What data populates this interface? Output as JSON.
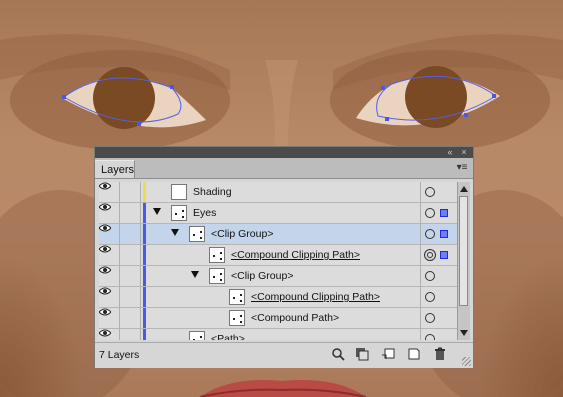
{
  "panel": {
    "tab_label": "Layers",
    "collapse_icon": "double-chevron-icon",
    "close_icon": "close-icon",
    "menu_icon": "panel-menu-icon"
  },
  "layers": [
    {
      "name": "Shading",
      "color": "#e8e04a",
      "indent": 0,
      "twisty": false,
      "underline": false,
      "selected": false,
      "target": "circle",
      "selected_art": false
    },
    {
      "name": "Eyes",
      "color": "#4a57e8",
      "indent": 0,
      "twisty": true,
      "underline": false,
      "selected": false,
      "target": "circle",
      "selected_art": true
    },
    {
      "name": "<Clip Group>",
      "color": "#4a57e8",
      "indent": 1,
      "twisty": true,
      "underline": false,
      "selected": true,
      "target": "circle",
      "selected_art": true
    },
    {
      "name": "<Compound Clipping Path>",
      "color": "#4a57e8",
      "indent": 2,
      "twisty": false,
      "underline": true,
      "selected": false,
      "target": "ring",
      "selected_art": true
    },
    {
      "name": "<Clip Group>",
      "color": "#4a57e8",
      "indent": 2,
      "twisty": true,
      "underline": false,
      "selected": false,
      "target": "circle",
      "selected_art": false
    },
    {
      "name": "<Compound Clipping Path>",
      "color": "#4a57e8",
      "indent": 3,
      "twisty": false,
      "underline": true,
      "selected": false,
      "target": "circle",
      "selected_art": false
    },
    {
      "name": "<Compound Path>",
      "color": "#4a57e8",
      "indent": 3,
      "twisty": false,
      "underline": false,
      "selected": false,
      "target": "circle",
      "selected_art": false
    },
    {
      "name": "<Path>",
      "color": "#4a57e8",
      "indent": 1,
      "twisty": false,
      "underline": false,
      "selected": false,
      "target": "circle",
      "selected_art": false
    }
  ],
  "footer": {
    "count_label": "7 Layers",
    "buttons": [
      "locate-object-icon",
      "make-clipping-mask-icon",
      "create-sublayer-icon",
      "new-layer-icon",
      "trash-icon"
    ]
  },
  "colors": {
    "selection": "#4a57e8",
    "selected_row": "#c4d4ea",
    "skin": "#b88966",
    "iris": "#7a4a24"
  }
}
